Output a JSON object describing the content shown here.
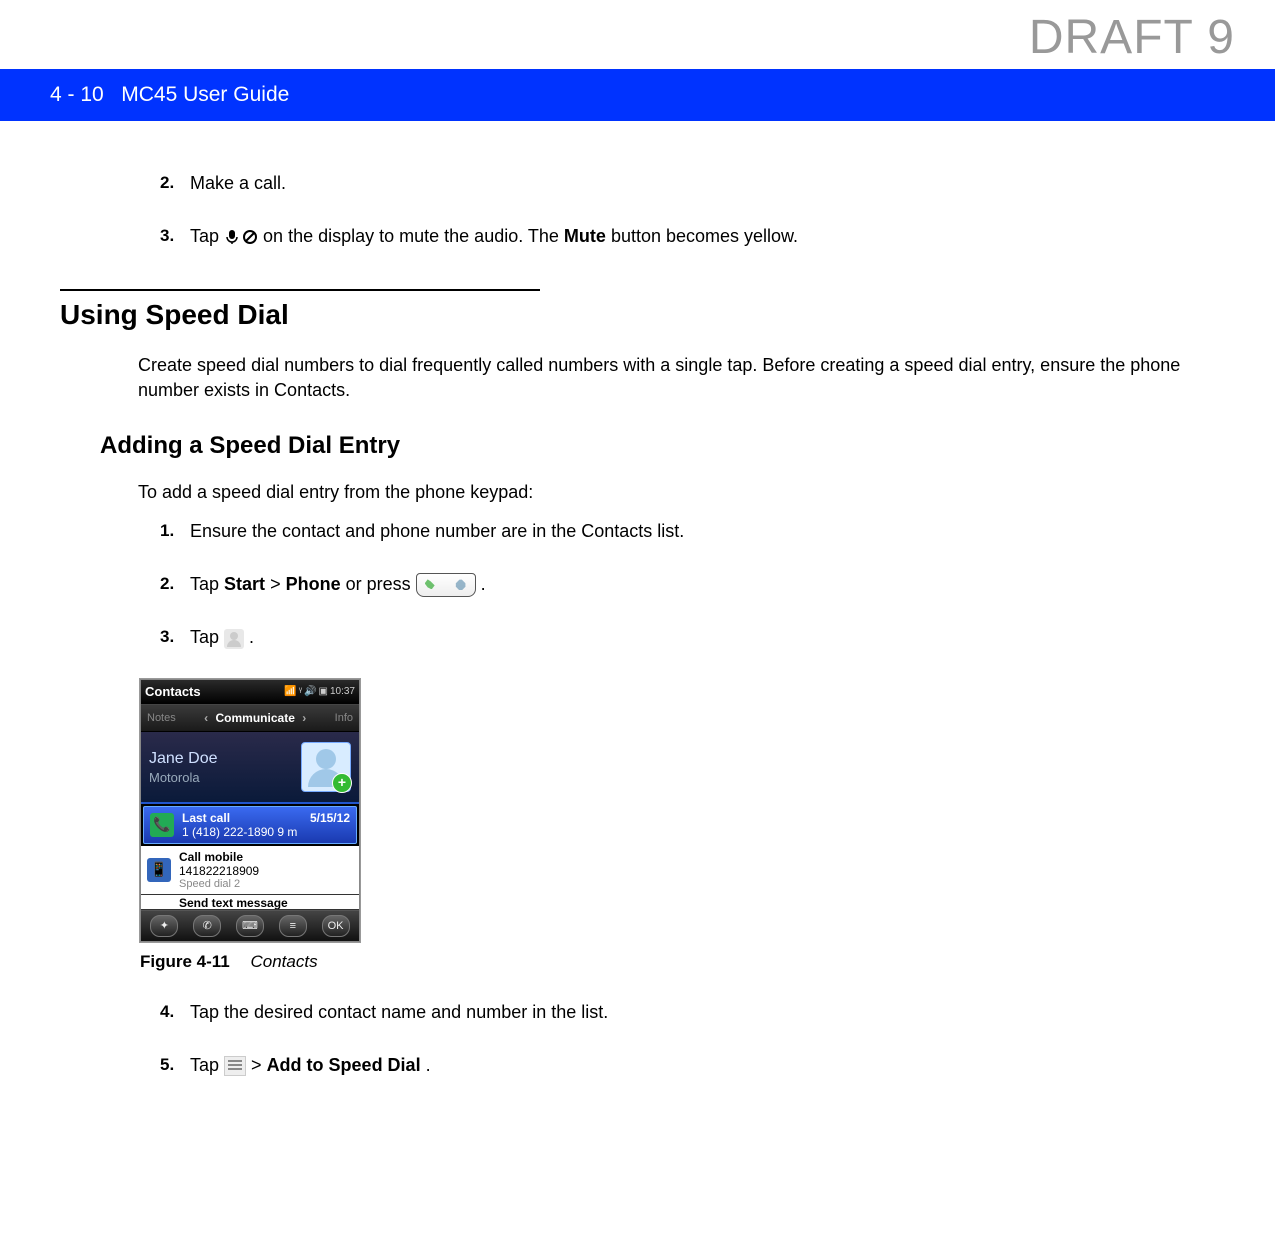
{
  "watermark": "DRAFT 9",
  "header": {
    "page_ref": "4 - 10",
    "guide_title": "MC45 User Guide"
  },
  "steps_top": {
    "s2": {
      "num": "2.",
      "text": "Make a call."
    },
    "s3": {
      "num": "3.",
      "prefix": "Tap ",
      "suffix_a": " on the display to mute the audio. The ",
      "bold": "Mute",
      "suffix_b": " button becomes yellow."
    }
  },
  "section": {
    "title": "Using Speed Dial",
    "desc": "Create speed dial numbers to dial frequently called numbers with a single tap. Before creating a speed dial entry, ensure the phone number exists in Contacts."
  },
  "subsection": {
    "title": "Adding a Speed Dial Entry",
    "desc": "To add a speed dial entry from the phone keypad:"
  },
  "steps_sub": {
    "s1": {
      "num": "1.",
      "text": "Ensure the contact and phone number are in the Contacts list."
    },
    "s2": {
      "num": "2.",
      "prefix": "Tap ",
      "b1": "Start",
      "sep": " > ",
      "b2": "Phone",
      "mid": " or press ",
      "suffix": "."
    },
    "s3": {
      "num": "3.",
      "prefix": "Tap ",
      "suffix": " ."
    },
    "s4": {
      "num": "4.",
      "text": "Tap the desired contact name and number in the list."
    },
    "s5": {
      "num": "5.",
      "prefix": "Tap  ",
      "sep": " > ",
      "bold": "Add to Speed Dial",
      "suffix": "."
    }
  },
  "device": {
    "title": "Contacts",
    "time": "10:37",
    "tabs": {
      "left": "Notes",
      "center": "Communicate",
      "right": "Info"
    },
    "contact": {
      "name": "Jane Doe",
      "company": "Motorola"
    },
    "row_lastcall": {
      "label": "Last call",
      "date": "5/15/12",
      "detail": "1 (418) 222-1890 9 m"
    },
    "row_mobile": {
      "label": "Call mobile",
      "number": "141822218909",
      "speed": "Speed dial 2"
    },
    "row_partial": "Send text message",
    "bottom_ok": "OK"
  },
  "figure": {
    "num": "Figure 4-11",
    "title": "Contacts"
  }
}
